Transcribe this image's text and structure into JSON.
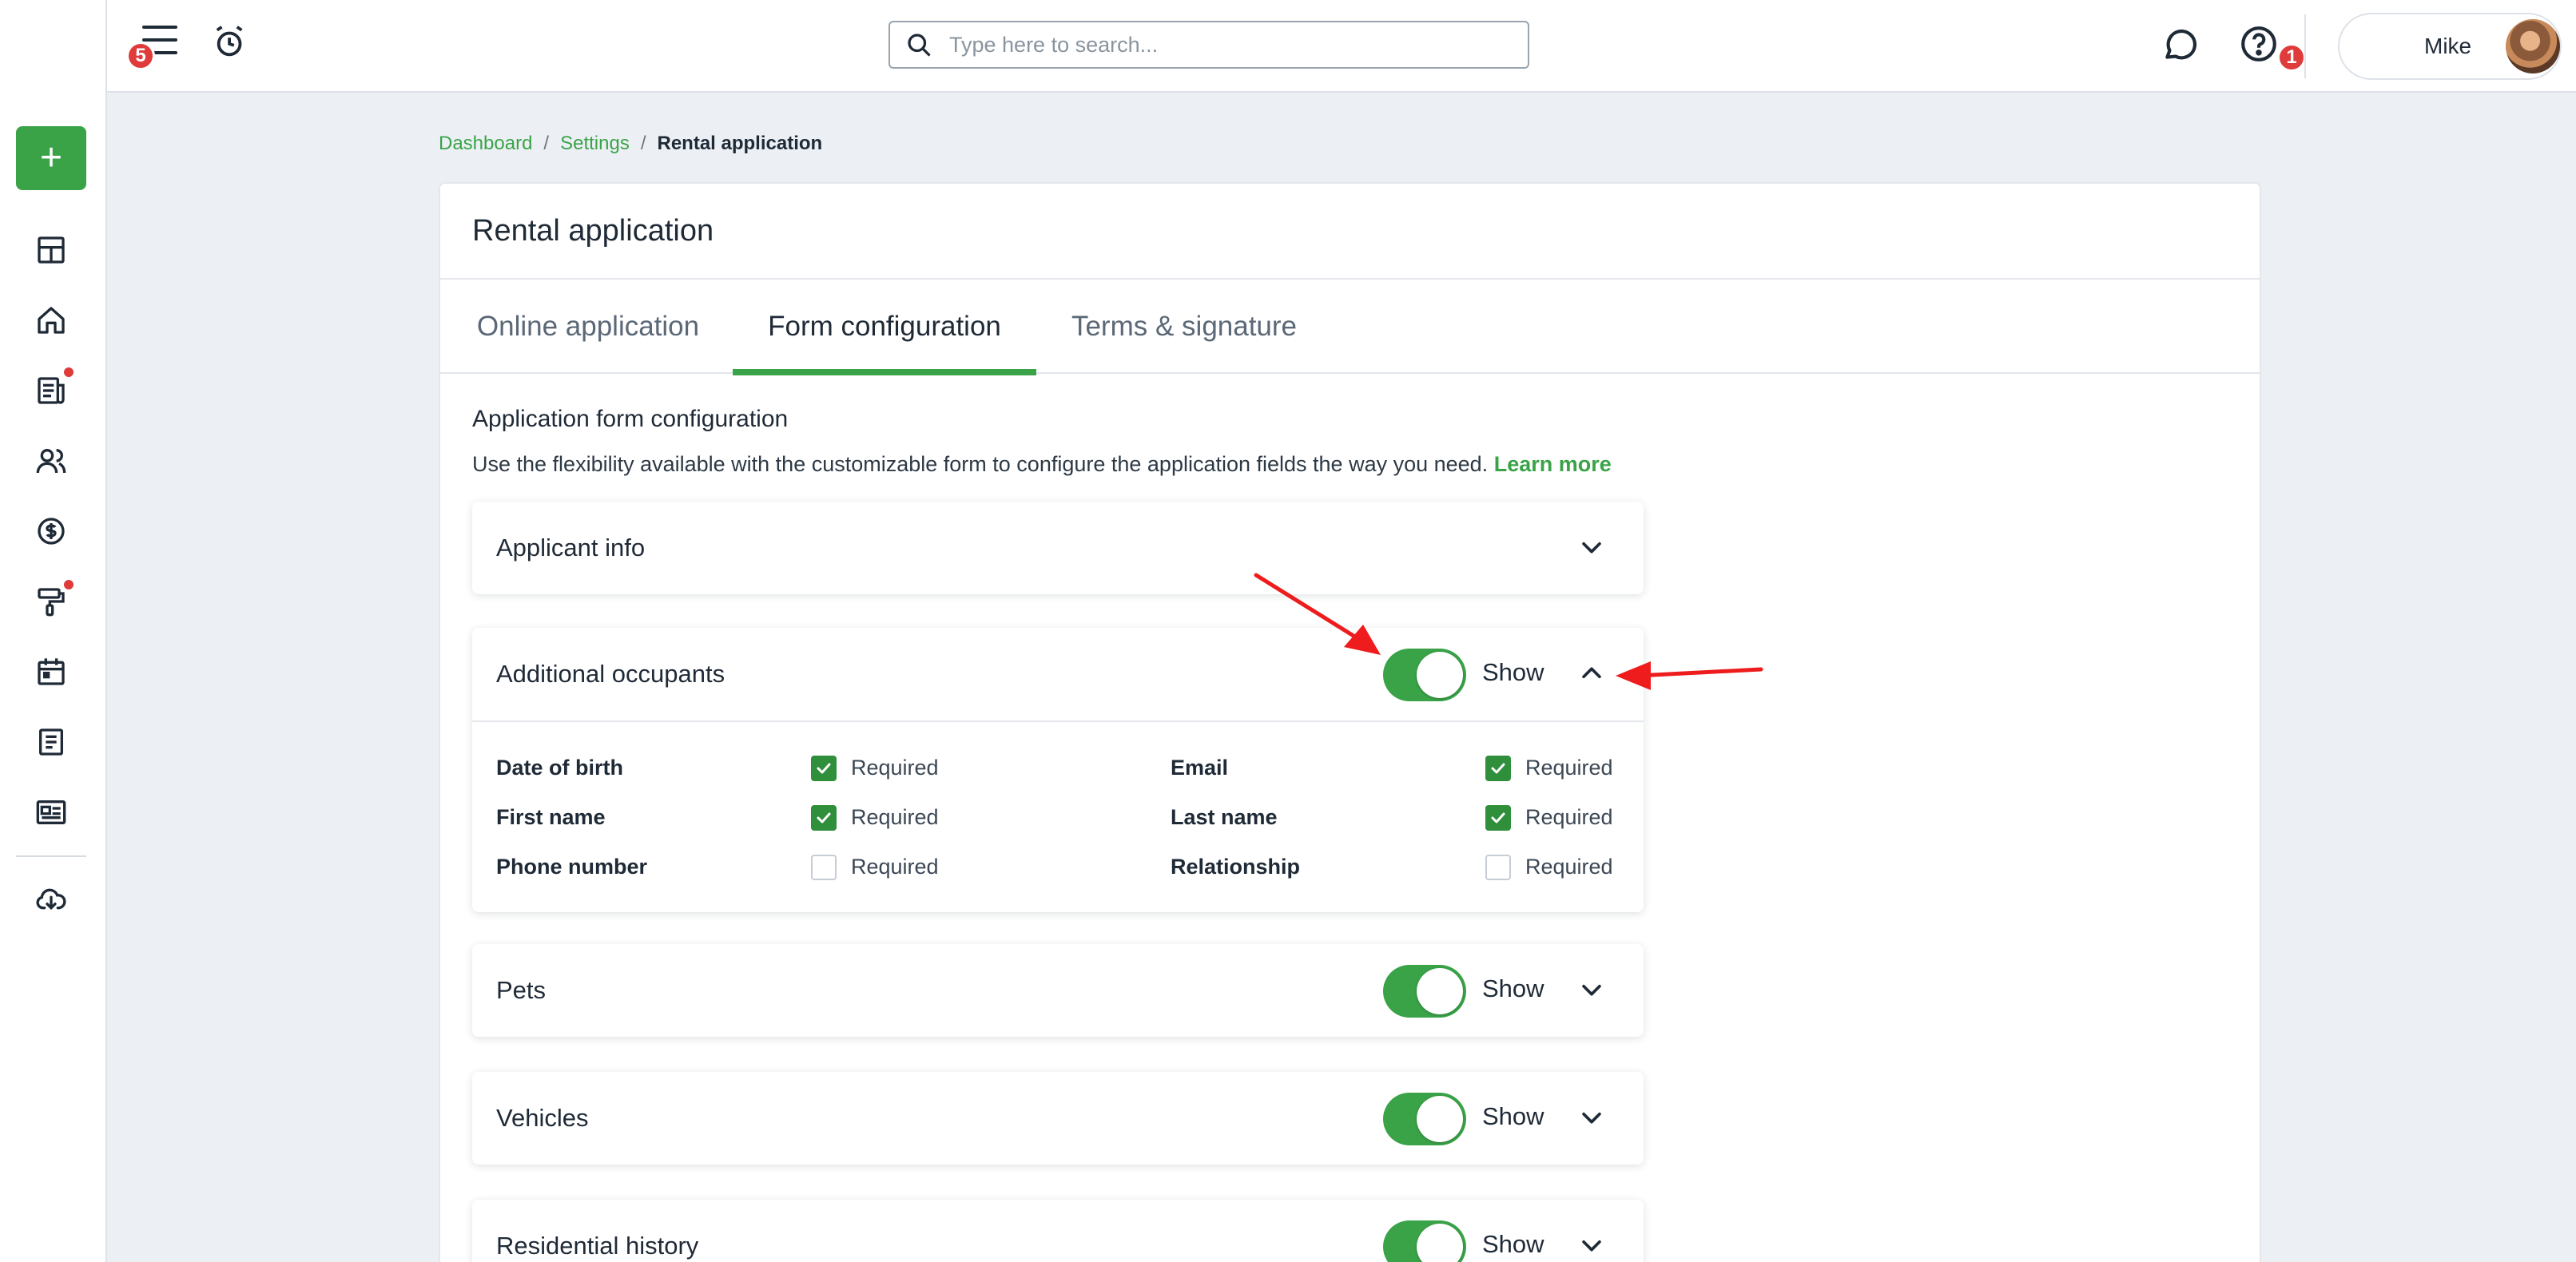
{
  "header": {
    "alerts_badge": "5",
    "search_placeholder": "Type here to search...",
    "messages_badge": "1",
    "user_name": "Mike"
  },
  "sidebar": {
    "add_label": "+",
    "items": [
      {
        "name": "dashboard",
        "icon": "grid-icon"
      },
      {
        "name": "properties",
        "icon": "home-icon"
      },
      {
        "name": "leasing",
        "icon": "newspaper-icon",
        "dot": true
      },
      {
        "name": "people",
        "icon": "people-icon"
      },
      {
        "name": "accounting",
        "icon": "dollar-icon"
      },
      {
        "name": "maintenance",
        "icon": "paint-roller-icon",
        "dot": true
      },
      {
        "name": "calendar",
        "icon": "calendar-icon"
      },
      {
        "name": "reports",
        "icon": "document-icon"
      },
      {
        "name": "communications",
        "icon": "id-card-icon"
      },
      {
        "name": "downloads",
        "icon": "cloud-download-icon"
      }
    ]
  },
  "breadcrumb": {
    "items": [
      "Dashboard",
      "Settings"
    ],
    "separator": "/",
    "current": "Rental application"
  },
  "page": {
    "title": "Rental application",
    "tabs": [
      "Online application",
      "Form configuration",
      "Terms & signature"
    ],
    "active_tab": "Form configuration"
  },
  "config": {
    "title": "Application form configuration",
    "description": "Use the flexibility available with the customizable form to configure the application fields the way you need.",
    "learn_more": "Learn more"
  },
  "sections": {
    "applicant_info": {
      "title": "Applicant info"
    },
    "additional_occupants": {
      "title": "Additional occupants",
      "show_label": "Show",
      "shown": true,
      "fields": [
        {
          "label": "Date of birth",
          "required": true
        },
        {
          "label": "Email",
          "required": true
        },
        {
          "label": "First name",
          "required": true
        },
        {
          "label": "Last name",
          "required": true
        },
        {
          "label": "Phone number",
          "required": false
        },
        {
          "label": "Relationship",
          "required": false
        }
      ],
      "required_label": "Required"
    },
    "pets": {
      "title": "Pets",
      "show_label": "Show",
      "shown": true
    },
    "vehicles": {
      "title": "Vehicles",
      "show_label": "Show",
      "shown": true
    },
    "residential_history": {
      "title": "Residential history",
      "show_label": "Show",
      "shown": true
    }
  },
  "colors": {
    "accent": "#3aa348",
    "badge": "#e03b3b",
    "annotation_arrow": "#ee1c1c"
  }
}
